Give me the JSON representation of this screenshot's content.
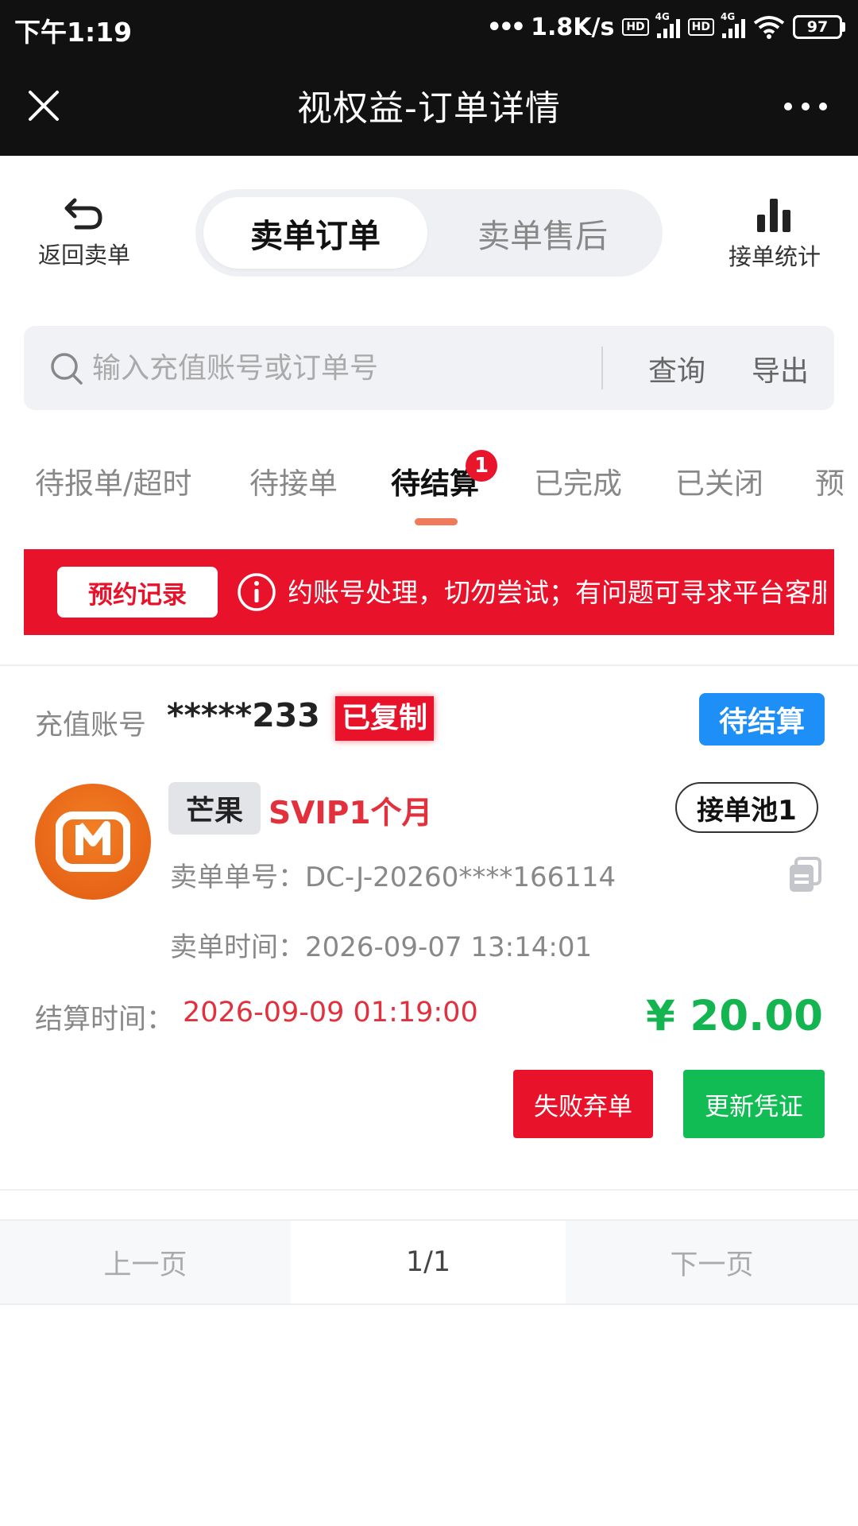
{
  "status_bar": {
    "time": "下午1:19",
    "speed": "1.8K/s",
    "hd": "HD",
    "network": "4G",
    "battery": "97"
  },
  "title_bar": {
    "title": "视权益-订单详情"
  },
  "toolbar": {
    "back_label": "返回卖单",
    "segment_active": "卖单订单",
    "segment_inactive": "卖单售后",
    "stats_label": "接单统计"
  },
  "search": {
    "placeholder": "输入充值账号或订单号",
    "query_label": "查询",
    "export_label": "导出"
  },
  "tabs": {
    "items": [
      "待报单/超时",
      "待接单",
      "待结算",
      "已完成",
      "已关闭",
      "预"
    ],
    "active_index": 2,
    "badge": "1"
  },
  "notice": {
    "button_label": "预约记录",
    "text": "注意：请勿使用已预约账号处理，切勿尝试；有问题可寻求平台客服"
  },
  "order": {
    "account_label": "充值账号",
    "account_value": "*****233",
    "copied_label": "已复制",
    "status": "待结算",
    "brand": "芒果",
    "product": "SVIP1个月",
    "pool": "接单池1",
    "order_no_label": "卖单单号：",
    "order_no": "DC-J-20260****166114",
    "sell_time_label": "卖单时间：",
    "sell_time": "2026-09-07 13:14:01",
    "settle_label": "结算时间：",
    "settle_time": "2026-09-09 01:19:00",
    "price": "¥ 20.00",
    "fail_button": "失败弃单",
    "update_button": "更新凭证"
  },
  "pager": {
    "prev": "上一页",
    "current": "1/1",
    "next": "下一页"
  },
  "colors": {
    "accent_red": "#e8132b",
    "status_blue": "#1e8ff7",
    "price_green": "#14b551",
    "brand_orange": "#f37f24"
  }
}
